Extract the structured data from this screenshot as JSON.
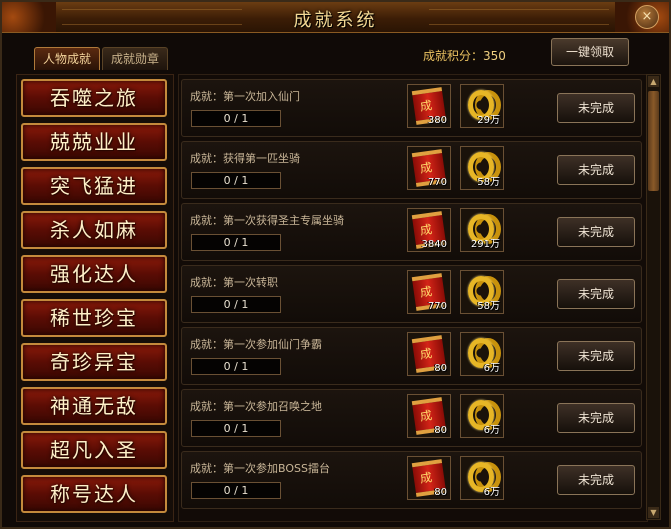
{
  "window": {
    "title": "成就系统",
    "close_label": "×"
  },
  "tabs": [
    {
      "label": "人物成就",
      "active": true
    },
    {
      "label": "成就勋章",
      "active": false
    }
  ],
  "score": {
    "label": "成就积分：",
    "value": "350"
  },
  "claim_all_label": "一键领取",
  "categories": [
    "吞噬之旅",
    "兢兢业业",
    "突飞猛进",
    "杀人如麻",
    "强化达人",
    "稀世珍宝",
    "奇珍异宝",
    "神通无敌",
    "超凡入圣",
    "称号达人"
  ],
  "achievements": [
    {
      "prefix": "成就：",
      "name": "第一次加入仙门",
      "progress": "0 / 1",
      "scroll_amount": "380",
      "coin_amount": "29万",
      "status": "未完成"
    },
    {
      "prefix": "成就：",
      "name": "获得第一匹坐骑",
      "progress": "0 / 1",
      "scroll_amount": "770",
      "coin_amount": "58万",
      "status": "未完成"
    },
    {
      "prefix": "成就：",
      "name": "第一次获得圣主专属坐骑",
      "progress": "0 / 1",
      "scroll_amount": "3840",
      "coin_amount": "291万",
      "status": "未完成"
    },
    {
      "prefix": "成就：",
      "name": "第一次转职",
      "progress": "0 / 1",
      "scroll_amount": "770",
      "coin_amount": "58万",
      "status": "未完成"
    },
    {
      "prefix": "成就：",
      "name": "第一次参加仙门争霸",
      "progress": "0 / 1",
      "scroll_amount": "80",
      "coin_amount": "6万",
      "status": "未完成"
    },
    {
      "prefix": "成就：",
      "name": "第一次参加召唤之地",
      "progress": "0 / 1",
      "scroll_amount": "80",
      "coin_amount": "6万",
      "status": "未完成"
    },
    {
      "prefix": "成就：",
      "name": "第一次参加BOSS擂台",
      "progress": "0 / 1",
      "scroll_amount": "80",
      "coin_amount": "6万",
      "status": "未完成"
    }
  ],
  "icons": {
    "scroll": "scroll-icon",
    "coin": "coin-icon",
    "scroll_glyph": "成"
  }
}
